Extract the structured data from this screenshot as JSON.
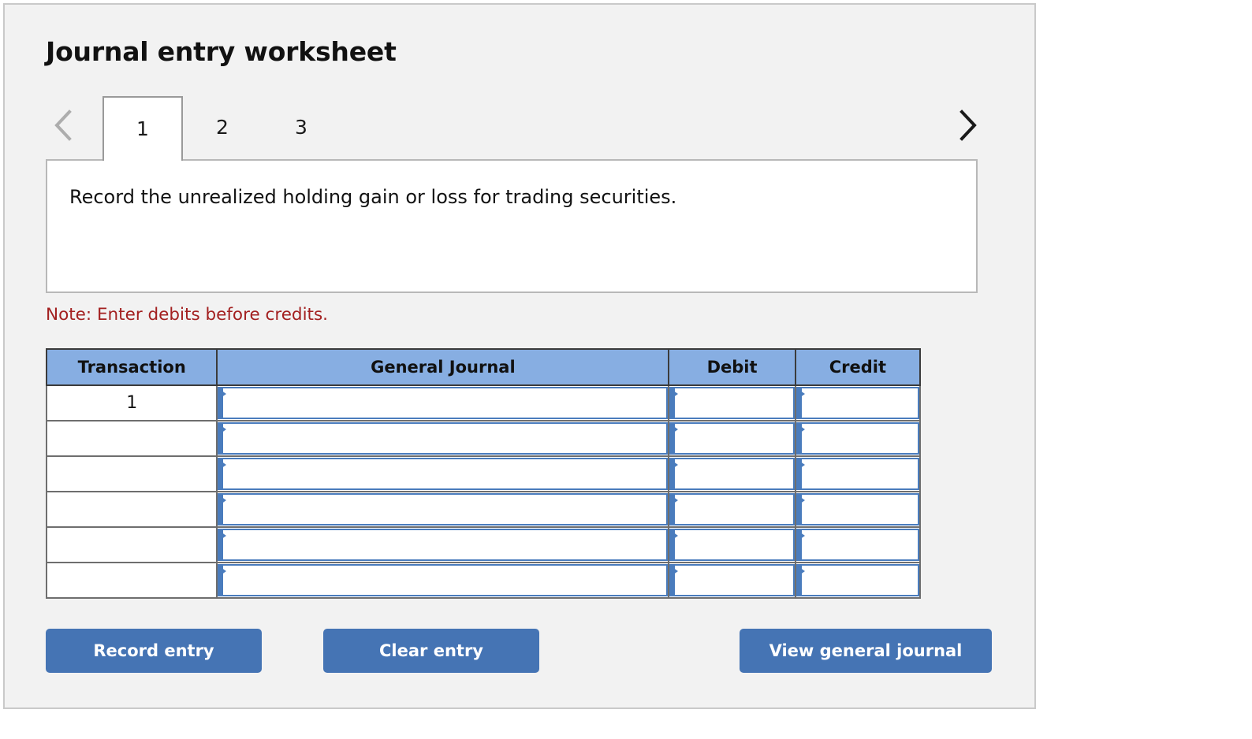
{
  "page": {
    "title": "Journal entry worksheet"
  },
  "nav": {
    "prev_icon": "chevron-left-icon",
    "next_icon": "chevron-right-icon",
    "tabs": [
      {
        "label": "1",
        "active": true
      },
      {
        "label": "2",
        "active": false
      },
      {
        "label": "3",
        "active": false
      }
    ]
  },
  "instruction": {
    "text": "Record the unrealized holding gain or loss for trading securities."
  },
  "note": {
    "text": "Note: Enter debits before credits."
  },
  "journal": {
    "columns": [
      "Transaction",
      "General Journal",
      "Debit",
      "Credit"
    ],
    "rows": [
      {
        "transaction": "1",
        "general_journal": "",
        "debit": "",
        "credit": ""
      },
      {
        "transaction": "",
        "general_journal": "",
        "debit": "",
        "credit": ""
      },
      {
        "transaction": "",
        "general_journal": "",
        "debit": "",
        "credit": ""
      },
      {
        "transaction": "",
        "general_journal": "",
        "debit": "",
        "credit": ""
      },
      {
        "transaction": "",
        "general_journal": "",
        "debit": "",
        "credit": ""
      },
      {
        "transaction": "",
        "general_journal": "",
        "debit": "",
        "credit": ""
      }
    ]
  },
  "actions": {
    "record_label": "Record entry",
    "clear_label": "Clear entry",
    "view_label": "View general journal"
  },
  "colors": {
    "header_blue": "#87aee2",
    "button_blue": "#4574b4",
    "field_blue": "#4a7cbd",
    "note_red": "#a32020",
    "panel_bg": "#f2f2f2"
  }
}
